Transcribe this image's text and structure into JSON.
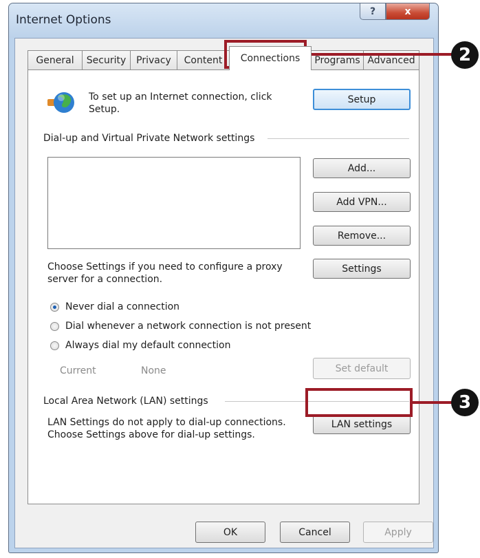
{
  "window": {
    "title": "Internet Options",
    "help_glyph": "?",
    "close_glyph": "x"
  },
  "tabs": [
    {
      "label": "General"
    },
    {
      "label": "Security"
    },
    {
      "label": "Privacy"
    },
    {
      "label": "Content"
    },
    {
      "label": "Connections",
      "active": true
    },
    {
      "label": "Programs"
    },
    {
      "label": "Advanced"
    }
  ],
  "setup": {
    "text": "To set up an Internet connection, click Setup.",
    "button": "Setup",
    "icon": "globe-network-icon"
  },
  "dialup": {
    "heading": "Dial-up and Virtual Private Network settings",
    "list_items": [],
    "add_button": "Add...",
    "add_vpn_button": "Add VPN...",
    "remove_button": "Remove...",
    "proxy_text": "Choose Settings if you need to configure a proxy server for a connection.",
    "settings_button": "Settings",
    "options": [
      {
        "label": "Never dial a connection",
        "selected": true
      },
      {
        "label": "Dial whenever a network connection is not present",
        "selected": false
      },
      {
        "label": "Always dial my default connection",
        "selected": false
      }
    ],
    "current_label": "Current",
    "current_value": "None",
    "set_default_button": "Set default"
  },
  "lan": {
    "heading": "Local Area Network (LAN) settings",
    "text": "LAN Settings do not apply to dial-up connections. Choose Settings above for dial-up settings.",
    "button": "LAN settings"
  },
  "footer": {
    "ok": "OK",
    "cancel": "Cancel",
    "apply": "Apply"
  },
  "callouts": {
    "connections_step": "2",
    "lan_step": "3",
    "color": "#9c1c27"
  }
}
